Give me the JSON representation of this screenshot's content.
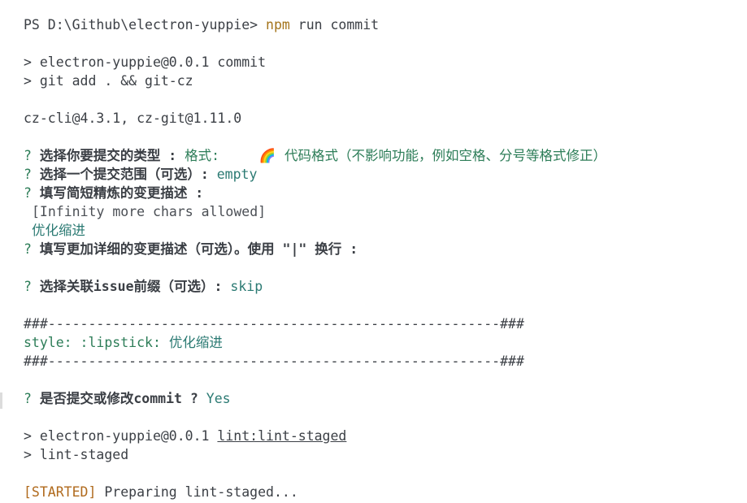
{
  "prompt": {
    "ps_prefix": "PS D:\\Github\\electron-yuppie> ",
    "cmd_npm": "npm",
    "cmd_rest": " run commit"
  },
  "npm_header": {
    "line1": "> electron-yuppie@0.0.1 commit",
    "line2": "> git add . && git-cz"
  },
  "versions": "cz-cli@4.3.1, cz-git@1.11.0",
  "q_type": {
    "mark": "? ",
    "label": "选择你要提交的类型 :",
    "value_prefix": " 格式:",
    "emoji": "🌈",
    "value_desc": " 代码格式（不影响功能，例如空格、分号等格式修正）"
  },
  "q_scope": {
    "mark": "? ",
    "label": "选择一个提交范围（可选）:",
    "value": " empty"
  },
  "q_subject": {
    "mark": "? ",
    "label": "填写简短精炼的变更描述 :",
    "hint": "[Infinity more chars allowed]",
    "answer": "优化缩进"
  },
  "q_body": {
    "mark": "? ",
    "label": "填写更加详细的变更描述（可选）。使用 \"|\" 换行 :"
  },
  "q_issue": {
    "mark": "? ",
    "label": "选择关联issue前缀（可选）:",
    "value": " skip"
  },
  "preview": {
    "divider": "###--------------------------------------------------------###",
    "message_type": "style: :lipstick: ",
    "message_text": "优化缩进"
  },
  "q_confirm": {
    "mark": "? ",
    "label": "是否提交或修改commit ?",
    "value": " Yes"
  },
  "lint": {
    "line1_prefix": "> electron-yuppie@0.0.1 ",
    "line1_script": "lint:lint-staged",
    "line2": "> lint-staged",
    "status_tag": "[STARTED]",
    "status_text": " Preparing lint-staged..."
  },
  "colors": {
    "background": "#ffffff",
    "text": "#3b3f45",
    "answer_green": "#2d7d58",
    "npm_gold": "#a4741b",
    "started_orange": "#b06a1d"
  }
}
